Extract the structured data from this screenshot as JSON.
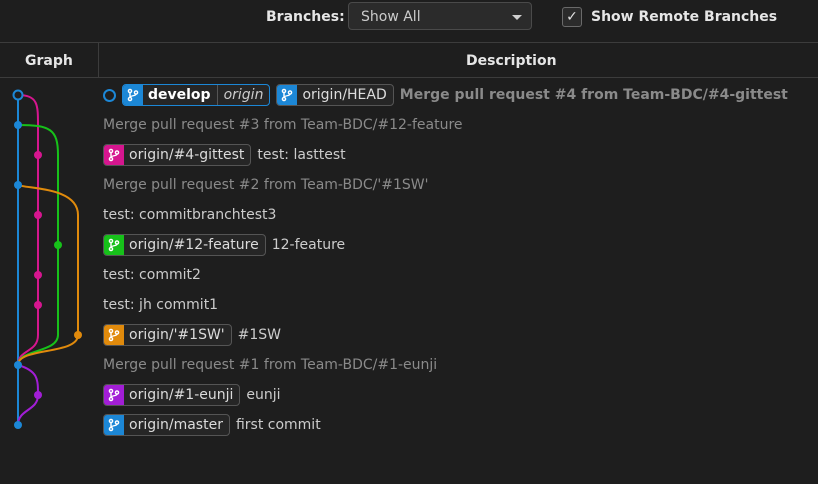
{
  "toolbar": {
    "branches_label": "Branches:",
    "branches_value": "Show All",
    "show_remote_checked": true,
    "show_remote_label": "Show Remote Branches"
  },
  "columns": {
    "graph": "Graph",
    "description": "Description"
  },
  "colors": {
    "blue": "#1c87d6",
    "magenta": "#d6168f",
    "green": "#17c11a",
    "orange": "#e08a0c",
    "purple": "#a21ed6"
  },
  "commits": [
    {
      "refs": [
        {
          "name": "develop",
          "tag": "origin",
          "color": "blue",
          "local": true
        },
        {
          "name": "origin/HEAD",
          "color": "blue"
        }
      ],
      "message": "Merge pull request #4 from Team-BDC/#4-gittest",
      "style": "bold-dim",
      "head": true
    },
    {
      "refs": [],
      "message": "Merge pull request #3 from Team-BDC/#12-feature",
      "style": "dim"
    },
    {
      "refs": [
        {
          "name": "origin/#4-gittest",
          "color": "magenta"
        }
      ],
      "message": "test: lasttest",
      "style": "normal"
    },
    {
      "refs": [],
      "message": "Merge pull request #2 from Team-BDC/'#1SW'",
      "style": "dim"
    },
    {
      "refs": [],
      "message": "test: commitbranchtest3",
      "style": "normal"
    },
    {
      "refs": [
        {
          "name": "origin/#12-feature",
          "color": "green"
        }
      ],
      "message": "12-feature",
      "style": "normal"
    },
    {
      "refs": [],
      "message": "test: commit2",
      "style": "normal"
    },
    {
      "refs": [],
      "message": "test: jh commit1",
      "style": "normal"
    },
    {
      "refs": [
        {
          "name": "origin/'#1SW'",
          "color": "orange"
        }
      ],
      "message": "#1SW",
      "style": "normal"
    },
    {
      "refs": [],
      "message": "Merge pull request #1 from Team-BDC/#1-eunji",
      "style": "dim"
    },
    {
      "refs": [
        {
          "name": "origin/#1-eunji",
          "color": "purple"
        }
      ],
      "message": "eunji",
      "style": "normal"
    },
    {
      "refs": [
        {
          "name": "origin/master",
          "color": "blue"
        }
      ],
      "message": "first commit",
      "style": "normal"
    }
  ]
}
